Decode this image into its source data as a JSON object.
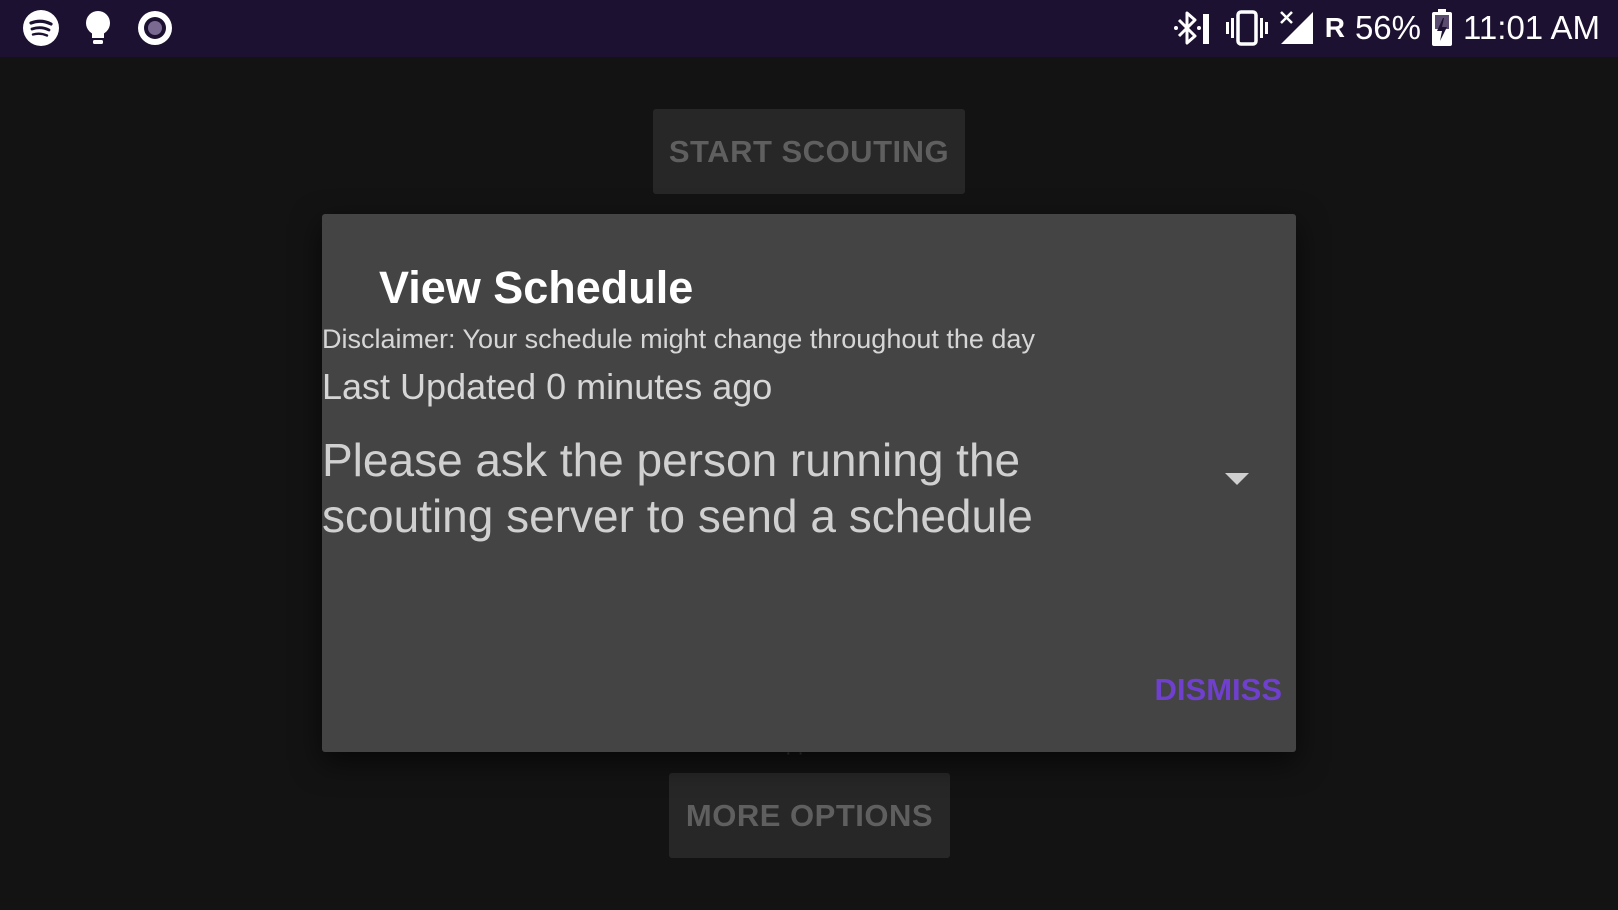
{
  "status_bar": {
    "left_icons": [
      "spotify-icon",
      "lightbulb-icon",
      "record-icon"
    ],
    "right_icons": [
      "bluetooth-icon",
      "vibrate-icon",
      "signal-no-service-icon",
      "roaming-icon",
      "battery-charging-icon"
    ],
    "roaming": "R",
    "battery": "56%",
    "time": "11:01 AM",
    "background_color": "#1c1130"
  },
  "background": {
    "start_button": "START SCOUTING",
    "more_options_button": "MORE OPTIONS",
    "fragment": "·  ·"
  },
  "dialog": {
    "title": "View Schedule",
    "disclaimer": "Disclaimer: Your schedule might change throughout the day",
    "last_updated": "Last Updated 0 minutes ago",
    "schedule_spinner": "Please ask the person running the scouting server to send a schedule",
    "dismiss_label": "DISMISS",
    "accent_color": "#6f3fce",
    "background_color": "#444444"
  }
}
